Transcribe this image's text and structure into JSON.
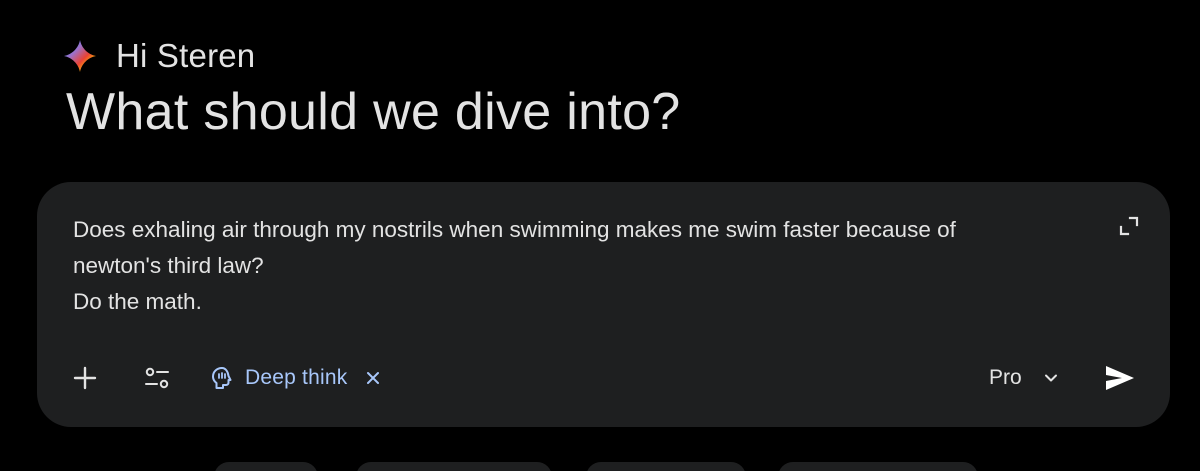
{
  "greeting": {
    "text": "Hi Steren",
    "icon": "gemini-sparkle-icon"
  },
  "headline": "What should we dive into?",
  "prompt": {
    "lines": [
      "Does exhaling air through my nostrils when swimming makes me swim faster because of",
      "newton's third law?",
      "Do the math."
    ]
  },
  "toolbar": {
    "add_icon": "plus-icon",
    "tools_icon": "tune-icon",
    "deep_think": {
      "label": "Deep think",
      "icon": "lightbulb-head-icon",
      "close_icon": "close-icon"
    },
    "model": {
      "label": "Pro",
      "icon": "chevron-down-icon"
    },
    "send_icon": "send-icon",
    "expand_icon": "expand-icon"
  },
  "colors": {
    "background": "#000000",
    "card": "#1e1f20",
    "text": "#e3e3e3",
    "accent": "#a8c7fa"
  }
}
